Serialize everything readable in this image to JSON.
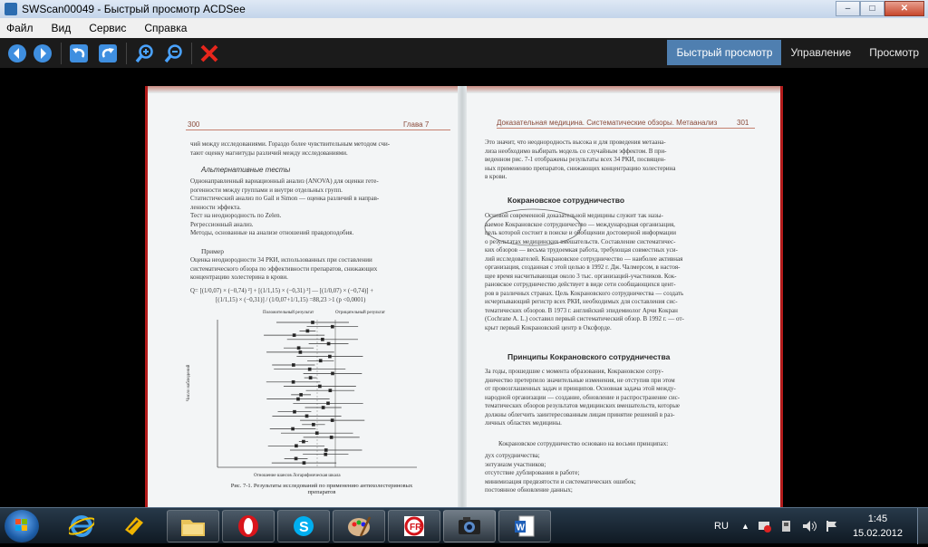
{
  "window": {
    "title": "SWScan00049 - Быстрый просмотр ACDSee",
    "min": "–",
    "max": "□",
    "close": "✕"
  },
  "menu": [
    "Файл",
    "Вид",
    "Сервис",
    "Справка"
  ],
  "toolbar": {
    "icons": [
      "back-arrow-icon",
      "forward-arrow-icon",
      "rotate-left-icon",
      "rotate-right-icon",
      "zoom-in-icon",
      "zoom-out-icon",
      "delete-icon"
    ]
  },
  "modes": {
    "quick": "Быстрый просмотр",
    "manage": "Управление",
    "view": "Просмотр"
  },
  "scan": {
    "left": {
      "page_no": "300",
      "chapter": "Глава 7",
      "p1": "чий между исследованиями. Гораздо более чувствительным методом счи-\nтают оценку магнитуды различий между исследованиями.",
      "alt_heading": "Альтернативные тесты",
      "bullets": [
        "Однонаправленный вариационный анализ (ANOVA) для оценки гете-\nрогенности между группами и внутри отдельных групп.",
        "Статистический анализ по Gail и Simon — оценка различий в направ-\nленности эффекта.",
        "Тест на неоднородность по Zelen.",
        "Регрессионный анализ.",
        "Методы, основанные на анализе отношений правдоподобия."
      ],
      "example_heading": "Пример",
      "p2": "Оценка неоднородности 34 РКИ, использованных при составлении\nсистематического обзора по эффективности препаратов, снижающих\nконцентрацию холестерина в крови.",
      "formula1": "Q= [(1/0,07) × (−0,74) ²] + [(1/1,15) × (−0,31) ²] — [(1/0,07) × (−0,74)] +",
      "formula2": "[(1/1,15) × (−0,31)] / (1/0,07+1/1,15) =88,23 >1 (p <0,0001)",
      "fig_pos": "Положительный результат",
      "fig_neg": "Отрицательный результат",
      "fig_ylabel": "Число наблюдений",
      "fig_xlabel": "Отношение шансов  Логарифмическая шкала",
      "caption": "Рис. 7-1. Результаты исследований по применению антихолестериновых\nпрепаратов"
    },
    "right": {
      "header": "Доказательная медицина. Систематические обзоры. Метаанализ",
      "page_no": "301",
      "p1": "Это значит, что неоднородность высока и для проведения метаана-\nлиза необходимо выбирать модель со случайным эффектом. В при-\nведенном рис. 7-1 отображены результаты всех 34 РКИ, посвящен-\nных применению препаратов, снижающих концентрацию холестерина\nв крови.",
      "h1": "Кокрановское сотрудничество",
      "p2": "Основой современной доказательной медицины служит так назы-\nваемое Кокрановское сотрудничество — международная организация,\nцель которой состоит в поиске и обобщении достоверной информации\nо результатах медицинских вмешательств. Составление систематичес-\nких обзоров — весьма трудоемкая работа, требующая совместных уси-\nлий исследователей. Кокрановское сотрудничество — наиболее активная\nорганизация, созданная с этой целью в 1992 г. Дж. Чалмерсом, в настоя-\nщее время насчитывающая около 3 тыс. организаций-участников. Кок-\nрановское сотрудничество действует в виде сети сообщающихся цент-\nров в различных странах. Цель Кокрановского сотрудничества — создать\nисчерпывающий регистр всех РКИ, необходимых для составления сис-\nтематических обзоров. В 1973 г. английский эпидемиолог Арчи Кокран\n(Cochrane A. L.) составил первый систематический обзор. В 1992 г. — от-\nкрыт первый Кокрановский центр в Оксфорде.",
      "h2": "Принципы Кокрановского сотрудничества",
      "p3": "За годы, прошедшие с момента образования, Кокрановское сотру-\nдничество претерпело значительные изменения, не отступив при этом\nот провозглашенных задач и принципов. Основная задача этой между-\nнародной организации — создание, обновление и распространение сис-\nтематических обзоров результатов медицинских вмешательств, которые\nдолжны облегчить заинтересованным лицам принятие решений в раз-\nличных областях медицины.",
      "p4": "Кокрановское сотрудничество основано на восьми принципах:",
      "bullets": [
        "дух сотрудничества;",
        "энтузиазм участников;",
        "отсутствие дублирования в работе;",
        "минимизация предвзятости и систематических ошибок;",
        "постоянное обновление данных;"
      ]
    }
  },
  "taskbar": {
    "apps": [
      "ie-icon",
      "winamp-icon",
      "explorer-folder-icon",
      "opera-icon",
      "skype-icon",
      "paint-icon",
      "finereader-icon",
      "acdsee-icon",
      "word-icon"
    ],
    "lang": "RU",
    "time": "1:45",
    "date": "15.02.2012"
  },
  "colors": {
    "accent": "#4f7fb0",
    "scanRed": "#b31b1b",
    "titleBar": "#c3d5ea"
  }
}
